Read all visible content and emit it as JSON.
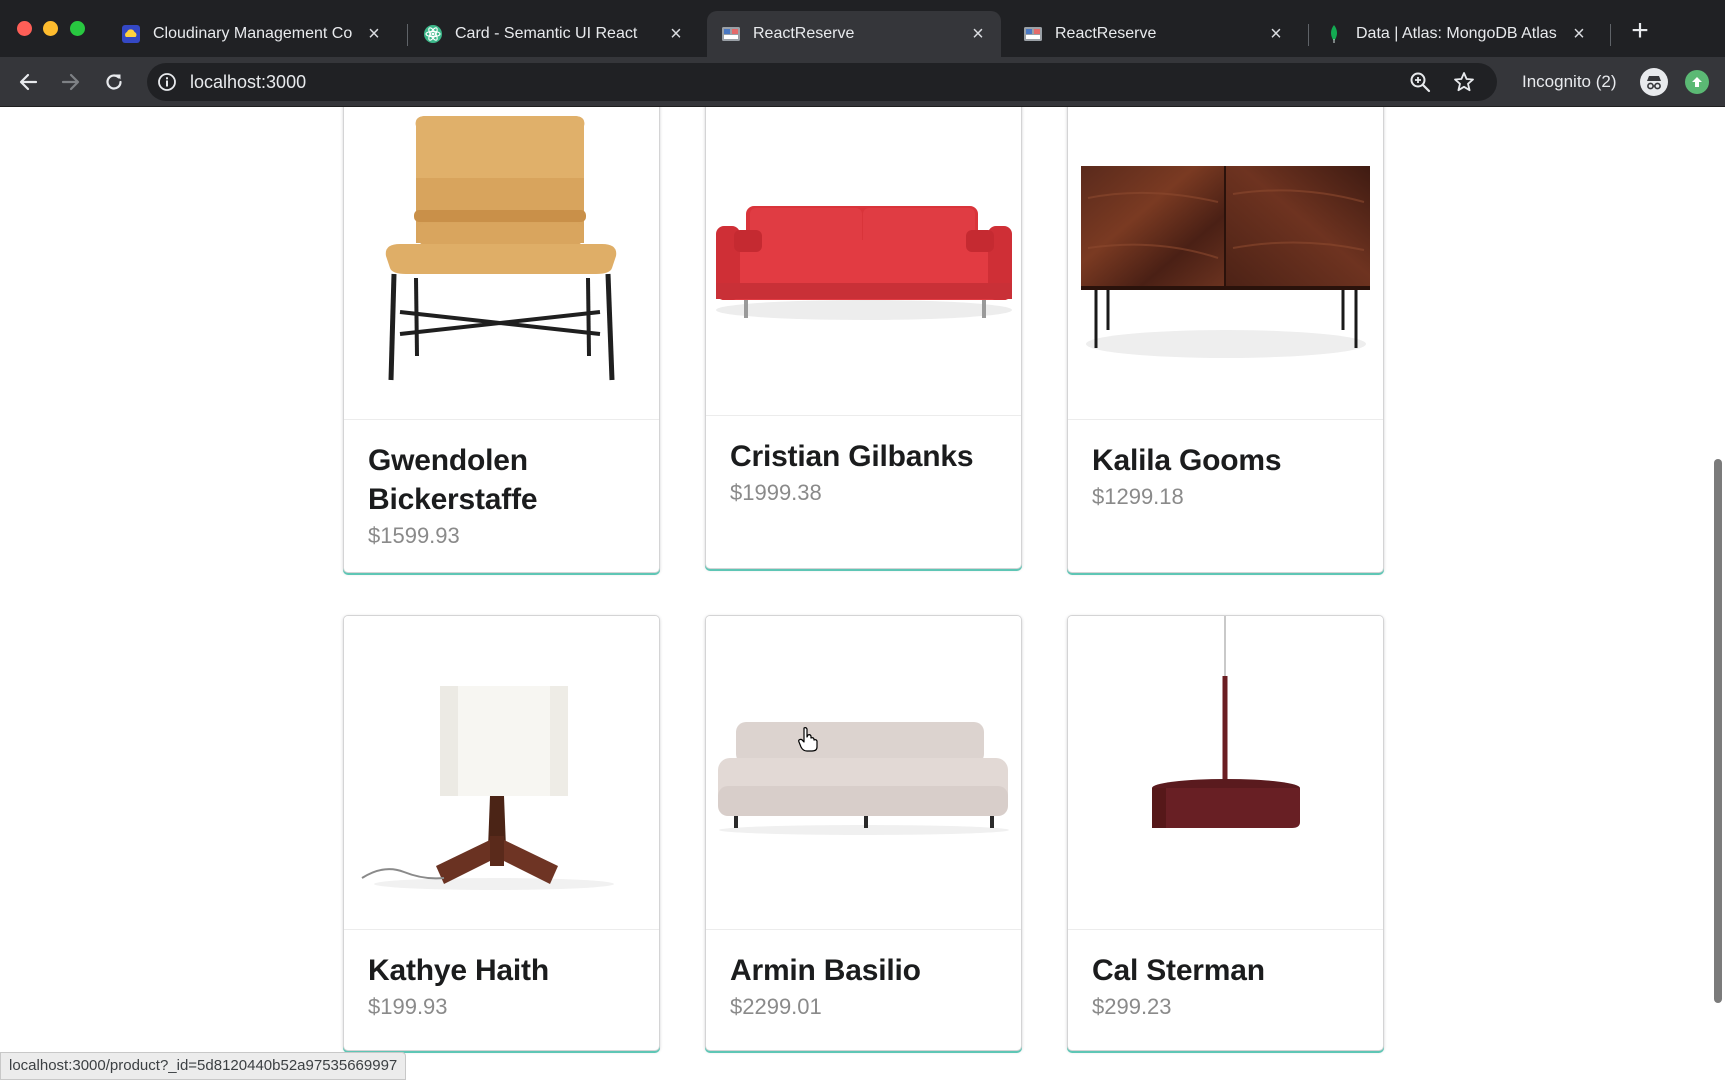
{
  "browser": {
    "tabs": [
      {
        "title": "Cloudinary Management Co",
        "icon": "cloudinary-icon",
        "active": false
      },
      {
        "title": "Card - Semantic UI React",
        "icon": "react-icon",
        "active": false
      },
      {
        "title": "ReactReserve",
        "icon": "reactreserve-icon",
        "active": true
      },
      {
        "title": "ReactReserve",
        "icon": "reactreserve-icon",
        "active": false
      },
      {
        "title": "Data | Atlas: MongoDB Atlas",
        "icon": "mongodb-leaf-icon",
        "active": false
      }
    ],
    "new_tab": "+",
    "close_glyph": "×",
    "url": "localhost:3000",
    "profile_label": "Incognito (2)"
  },
  "products": [
    {
      "name": "Gwendolen Bickerstaffe",
      "price": "$1599.93",
      "image": "lounge-chair"
    },
    {
      "name": "Cristian Gilbanks",
      "price": "$1999.38",
      "image": "red-sofa"
    },
    {
      "name": "Kalila Gooms",
      "price": "$1299.18",
      "image": "walnut-sideboard"
    },
    {
      "name": "Kathye Haith",
      "price": "$199.93",
      "image": "table-lamp"
    },
    {
      "name": "Armin Basilio",
      "price": "$2299.01",
      "image": "grey-sofa"
    },
    {
      "name": "Cal Sterman",
      "price": "$299.23",
      "image": "pendant-light"
    }
  ],
  "status_bar": {
    "text": "localhost:3000/product?_id=5d8120440b52a97535669997"
  },
  "colors": {
    "card_accent": "#5ec6b5",
    "chrome_dark": "#202124",
    "chrome_toolbar": "#35363a"
  }
}
